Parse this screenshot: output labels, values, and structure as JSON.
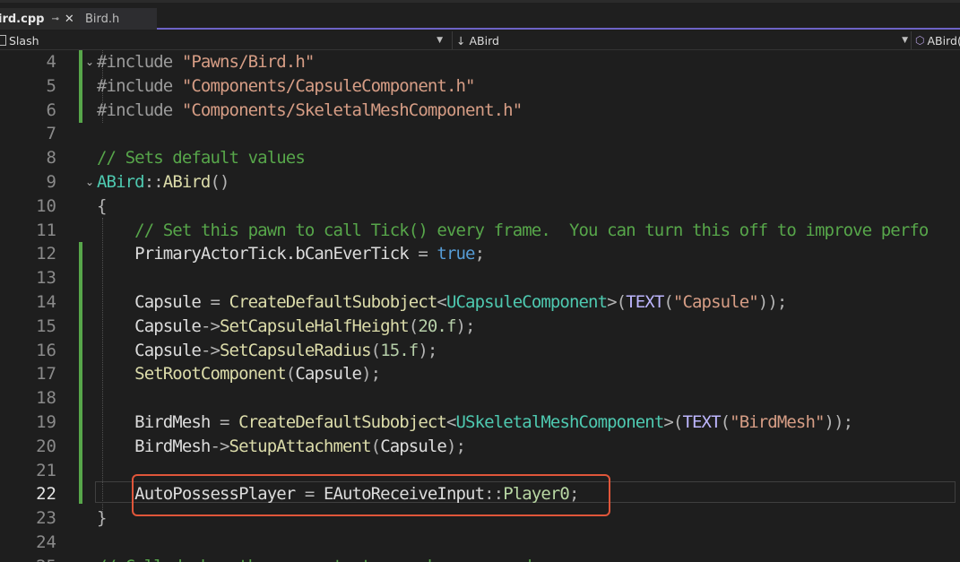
{
  "tabs": [
    {
      "label": "ird.cpp",
      "pin": "⊸",
      "close": "✕"
    },
    {
      "label": "Bird.h"
    }
  ],
  "navbar": {
    "project": "Slash",
    "scope": "ABird",
    "member": "ABird("
  },
  "lines": [
    {
      "num": "4",
      "segments": [
        [
          "pre",
          "#include "
        ],
        [
          "str",
          "\"Pawns/Bird.h\""
        ]
      ]
    },
    {
      "num": "5",
      "segments": [
        [
          "pre",
          "#include "
        ],
        [
          "str",
          "\"Components/CapsuleComponent.h\""
        ]
      ]
    },
    {
      "num": "6",
      "segments": [
        [
          "pre",
          "#include "
        ],
        [
          "str",
          "\"Components/SkeletalMeshComponent.h\""
        ]
      ]
    },
    {
      "num": "7",
      "segments": []
    },
    {
      "num": "8",
      "segments": [
        [
          "com",
          "// Sets default values"
        ]
      ]
    },
    {
      "num": "9",
      "segments": [
        [
          "type",
          "ABird"
        ],
        [
          "op",
          "::"
        ],
        [
          "fn",
          "ABird"
        ],
        [
          "op",
          "()"
        ]
      ]
    },
    {
      "num": "10",
      "segments": [
        [
          "op",
          "{"
        ]
      ]
    },
    {
      "num": "11",
      "segments": [
        [
          "txt",
          "    "
        ],
        [
          "com",
          "// Set this pawn to call Tick() every frame.  You can turn this off to improve perfo"
        ]
      ]
    },
    {
      "num": "12",
      "segments": [
        [
          "txt",
          "    PrimaryActorTick.bCanEverTick "
        ],
        [
          "op",
          "="
        ],
        [
          "txt",
          " "
        ],
        [
          "kw",
          "true"
        ],
        [
          "op",
          ";"
        ]
      ]
    },
    {
      "num": "13",
      "segments": []
    },
    {
      "num": "14",
      "segments": [
        [
          "txt",
          "    Capsule "
        ],
        [
          "op",
          "="
        ],
        [
          "txt",
          " "
        ],
        [
          "fn",
          "CreateDefaultSubobject"
        ],
        [
          "op",
          "<"
        ],
        [
          "type",
          "UCapsuleComponent"
        ],
        [
          "op",
          ">("
        ],
        [
          "mac",
          "TEXT"
        ],
        [
          "op",
          "("
        ],
        [
          "str",
          "\"Capsule\""
        ],
        [
          "op",
          "));"
        ]
      ]
    },
    {
      "num": "15",
      "segments": [
        [
          "txt",
          "    Capsule"
        ],
        [
          "op",
          "->"
        ],
        [
          "fn",
          "SetCapsuleHalfHeight"
        ],
        [
          "op",
          "("
        ],
        [
          "num",
          "20.f"
        ],
        [
          "op",
          ");"
        ]
      ]
    },
    {
      "num": "16",
      "segments": [
        [
          "txt",
          "    Capsule"
        ],
        [
          "op",
          "->"
        ],
        [
          "fn",
          "SetCapsuleRadius"
        ],
        [
          "op",
          "("
        ],
        [
          "num",
          "15.f"
        ],
        [
          "op",
          ");"
        ]
      ]
    },
    {
      "num": "17",
      "segments": [
        [
          "txt",
          "    "
        ],
        [
          "fn",
          "SetRootComponent"
        ],
        [
          "op",
          "("
        ],
        [
          "txt",
          "Capsule"
        ],
        [
          "op",
          ");"
        ]
      ]
    },
    {
      "num": "18",
      "segments": []
    },
    {
      "num": "19",
      "segments": [
        [
          "txt",
          "    BirdMesh "
        ],
        [
          "op",
          "="
        ],
        [
          "txt",
          " "
        ],
        [
          "fn",
          "CreateDefaultSubobject"
        ],
        [
          "op",
          "<"
        ],
        [
          "type",
          "USkeletalMeshComponent"
        ],
        [
          "op",
          ">("
        ],
        [
          "mac",
          "TEXT"
        ],
        [
          "op",
          "("
        ],
        [
          "str",
          "\"BirdMesh\""
        ],
        [
          "op",
          "));"
        ]
      ]
    },
    {
      "num": "20",
      "segments": [
        [
          "txt",
          "    BirdMesh"
        ],
        [
          "op",
          "->"
        ],
        [
          "fn",
          "SetupAttachment"
        ],
        [
          "op",
          "("
        ],
        [
          "txt",
          "Capsule"
        ],
        [
          "op",
          ");"
        ]
      ]
    },
    {
      "num": "21",
      "segments": []
    },
    {
      "num": "22",
      "segments": [
        [
          "txt",
          "    AutoPossessPlayer "
        ],
        [
          "op",
          "="
        ],
        [
          "txt",
          " EAutoReceiveInput"
        ],
        [
          "op",
          "::"
        ],
        [
          "enum",
          "Player0"
        ],
        [
          "op",
          ";"
        ]
      ]
    },
    {
      "num": "23",
      "segments": [
        [
          "op",
          "}"
        ]
      ]
    },
    {
      "num": "24",
      "segments": []
    },
    {
      "num": "25",
      "segments": [
        [
          "com",
          "// Called when the game starts or when spawned"
        ]
      ]
    }
  ],
  "current_line": "22",
  "colors": {
    "accent": "#6d63c6",
    "change_bar": "#57a64a",
    "highlight_box": "#e0563a"
  }
}
